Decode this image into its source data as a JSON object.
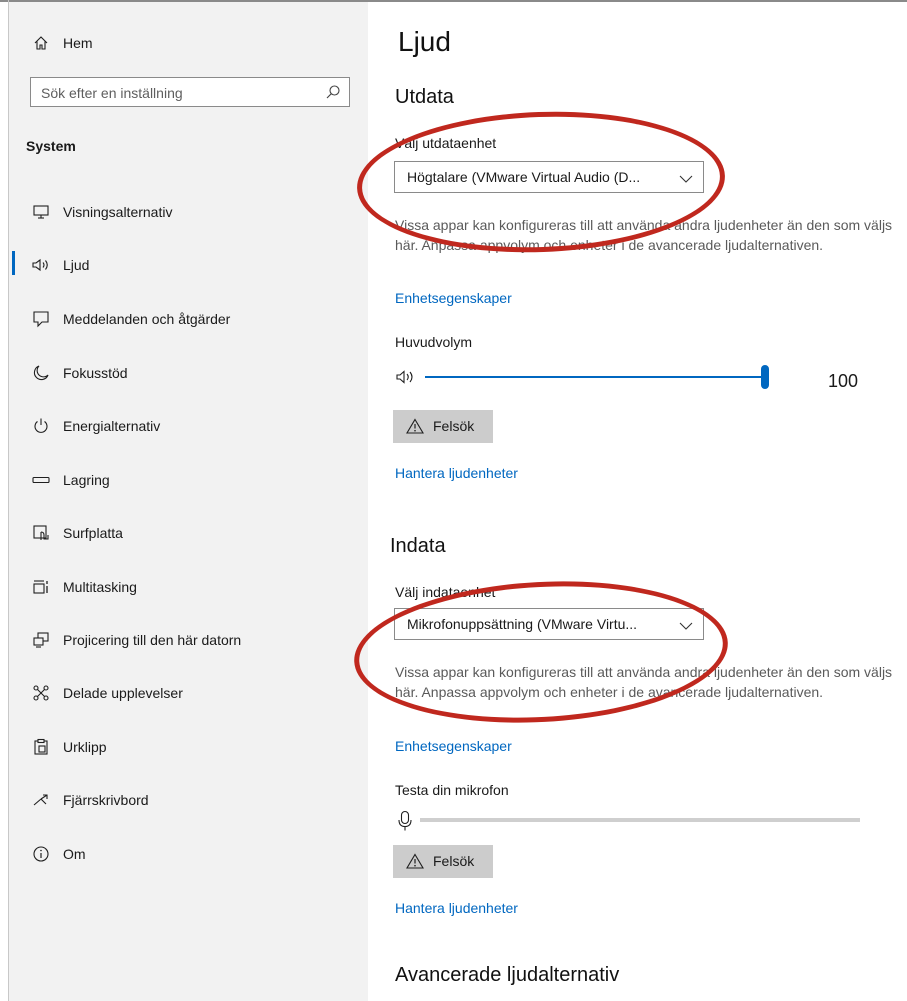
{
  "sidebar": {
    "home_label": "Hem",
    "search_placeholder": "Sök efter en inställning",
    "section_title": "System",
    "items": [
      {
        "label": "Visningsalternativ",
        "icon": "monitor-icon"
      },
      {
        "label": "Ljud",
        "icon": "speaker-icon",
        "active": true
      },
      {
        "label": "Meddelanden och åtgärder",
        "icon": "message-icon"
      },
      {
        "label": "Fokusstöd",
        "icon": "moon-icon"
      },
      {
        "label": "Energialternativ",
        "icon": "power-icon"
      },
      {
        "label": "Lagring",
        "icon": "storage-icon"
      },
      {
        "label": "Surfplatta",
        "icon": "tablet-icon"
      },
      {
        "label": "Multitasking",
        "icon": "multitasking-icon"
      },
      {
        "label": "Projicering till den här datorn",
        "icon": "project-icon"
      },
      {
        "label": "Delade upplevelser",
        "icon": "shared-icon"
      },
      {
        "label": "Urklipp",
        "icon": "clipboard-icon"
      },
      {
        "label": "Fjärrskrivbord",
        "icon": "remote-desktop-icon"
      },
      {
        "label": "Om",
        "icon": "info-icon"
      }
    ]
  },
  "main": {
    "page_title": "Ljud",
    "output": {
      "heading": "Utdata",
      "device_label": "Välj utdataenhet",
      "device_value": "Högtalare (VMware Virtual Audio (D...",
      "description": "Vissa appar kan konfigureras till att använda andra ljudenheter än den som väljs här. Anpassa appvolym och enheter i de avancerade ljudalternativen.",
      "properties_link": "Enhetsegenskaper",
      "volume_label": "Huvudvolym",
      "volume_value": "100",
      "volume_fraction": 1.0,
      "troubleshoot_label": "Felsök",
      "manage_link": "Hantera ljudenheter"
    },
    "input": {
      "heading": "Indata",
      "device_label": "Välj indataenhet",
      "device_value": "Mikrofonuppsättning (VMware Virtu...",
      "description": "Vissa appar kan konfigureras till att använda andra ljudenheter än den som väljs här. Anpassa appvolym och enheter i de avancerade ljudalternativen.",
      "properties_link": "Enhetsegenskaper",
      "mic_test_label": "Testa din mikrofon",
      "mic_level_fraction": 0.0,
      "troubleshoot_label": "Felsök",
      "manage_link": "Hantera ljudenheter"
    },
    "advanced_heading": "Avancerade ljudalternativ"
  },
  "colors": {
    "accent": "#0067c0",
    "annotation_red": "#c0281e",
    "sidebar_bg": "#f2f2f2",
    "button_bg": "#cccccc"
  }
}
